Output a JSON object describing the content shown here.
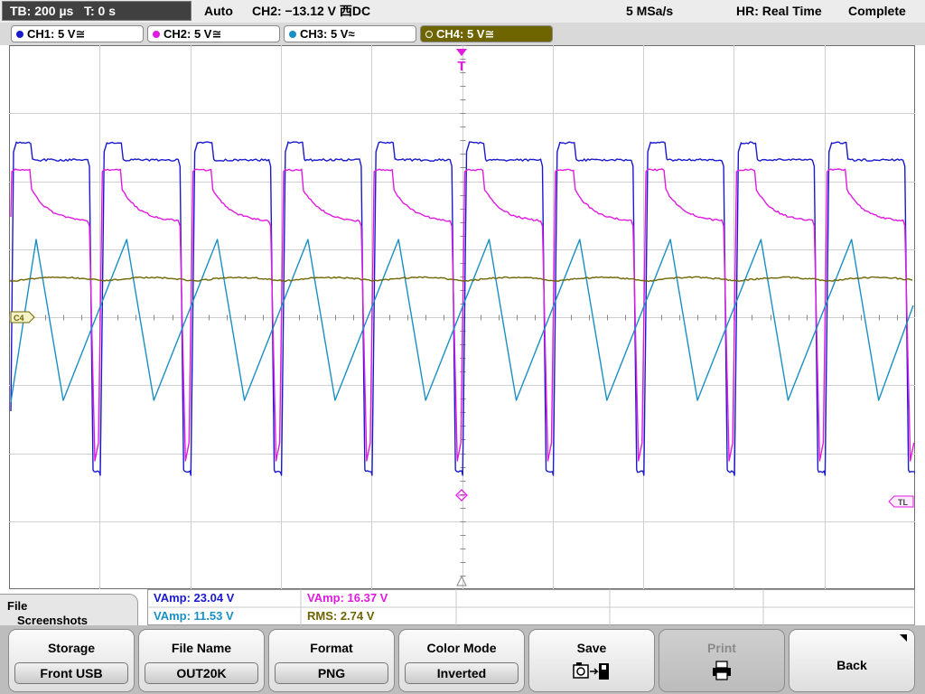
{
  "status": {
    "timebase": "TB: 200 µs",
    "trigger_time": "T: 0 s",
    "mode": "Auto",
    "trigger_info": "CH2: −13.12 V ⻄DC",
    "sample_rate": "5 MSa/s",
    "acq_mode": "HR: Real Time",
    "acq_status": "Complete"
  },
  "channels": [
    {
      "label": "CH1: 5 V≅",
      "color": "#1a1acd"
    },
    {
      "label": "CH2: 5 V≅",
      "color": "#e01ae0"
    },
    {
      "label": "CH3: 5 V≈",
      "color": "#1a8fc4"
    },
    {
      "label": "CH4: 5 V≅",
      "color": "#6e6500"
    }
  ],
  "markers": {
    "trigger": "T",
    "ground_ch4": "C4",
    "trigger_level": "TL"
  },
  "measurements": [
    {
      "text": "VAmp: 23.04 V",
      "color": "#1a1acd"
    },
    {
      "text": "VAmp: 16.37 V",
      "color": "#e01ae0"
    },
    {
      "text": "VAmp: 11.53 V",
      "color": "#1a8fc4"
    },
    {
      "text": "RMS: 2.74 V",
      "color": "#6e6500"
    }
  ],
  "menu": {
    "title_line1": "File",
    "title_line2": "Screenshots"
  },
  "softkeys": {
    "storage": {
      "label": "Storage",
      "value": "Front USB"
    },
    "file_name": {
      "label": "File Name",
      "value": "OUT20K"
    },
    "format": {
      "label": "Format",
      "value": "PNG"
    },
    "color_mode": {
      "label": "Color Mode",
      "value": "Inverted"
    },
    "save": {
      "label": "Save"
    },
    "print": {
      "label": "Print"
    },
    "back": {
      "label": "Back"
    }
  }
}
